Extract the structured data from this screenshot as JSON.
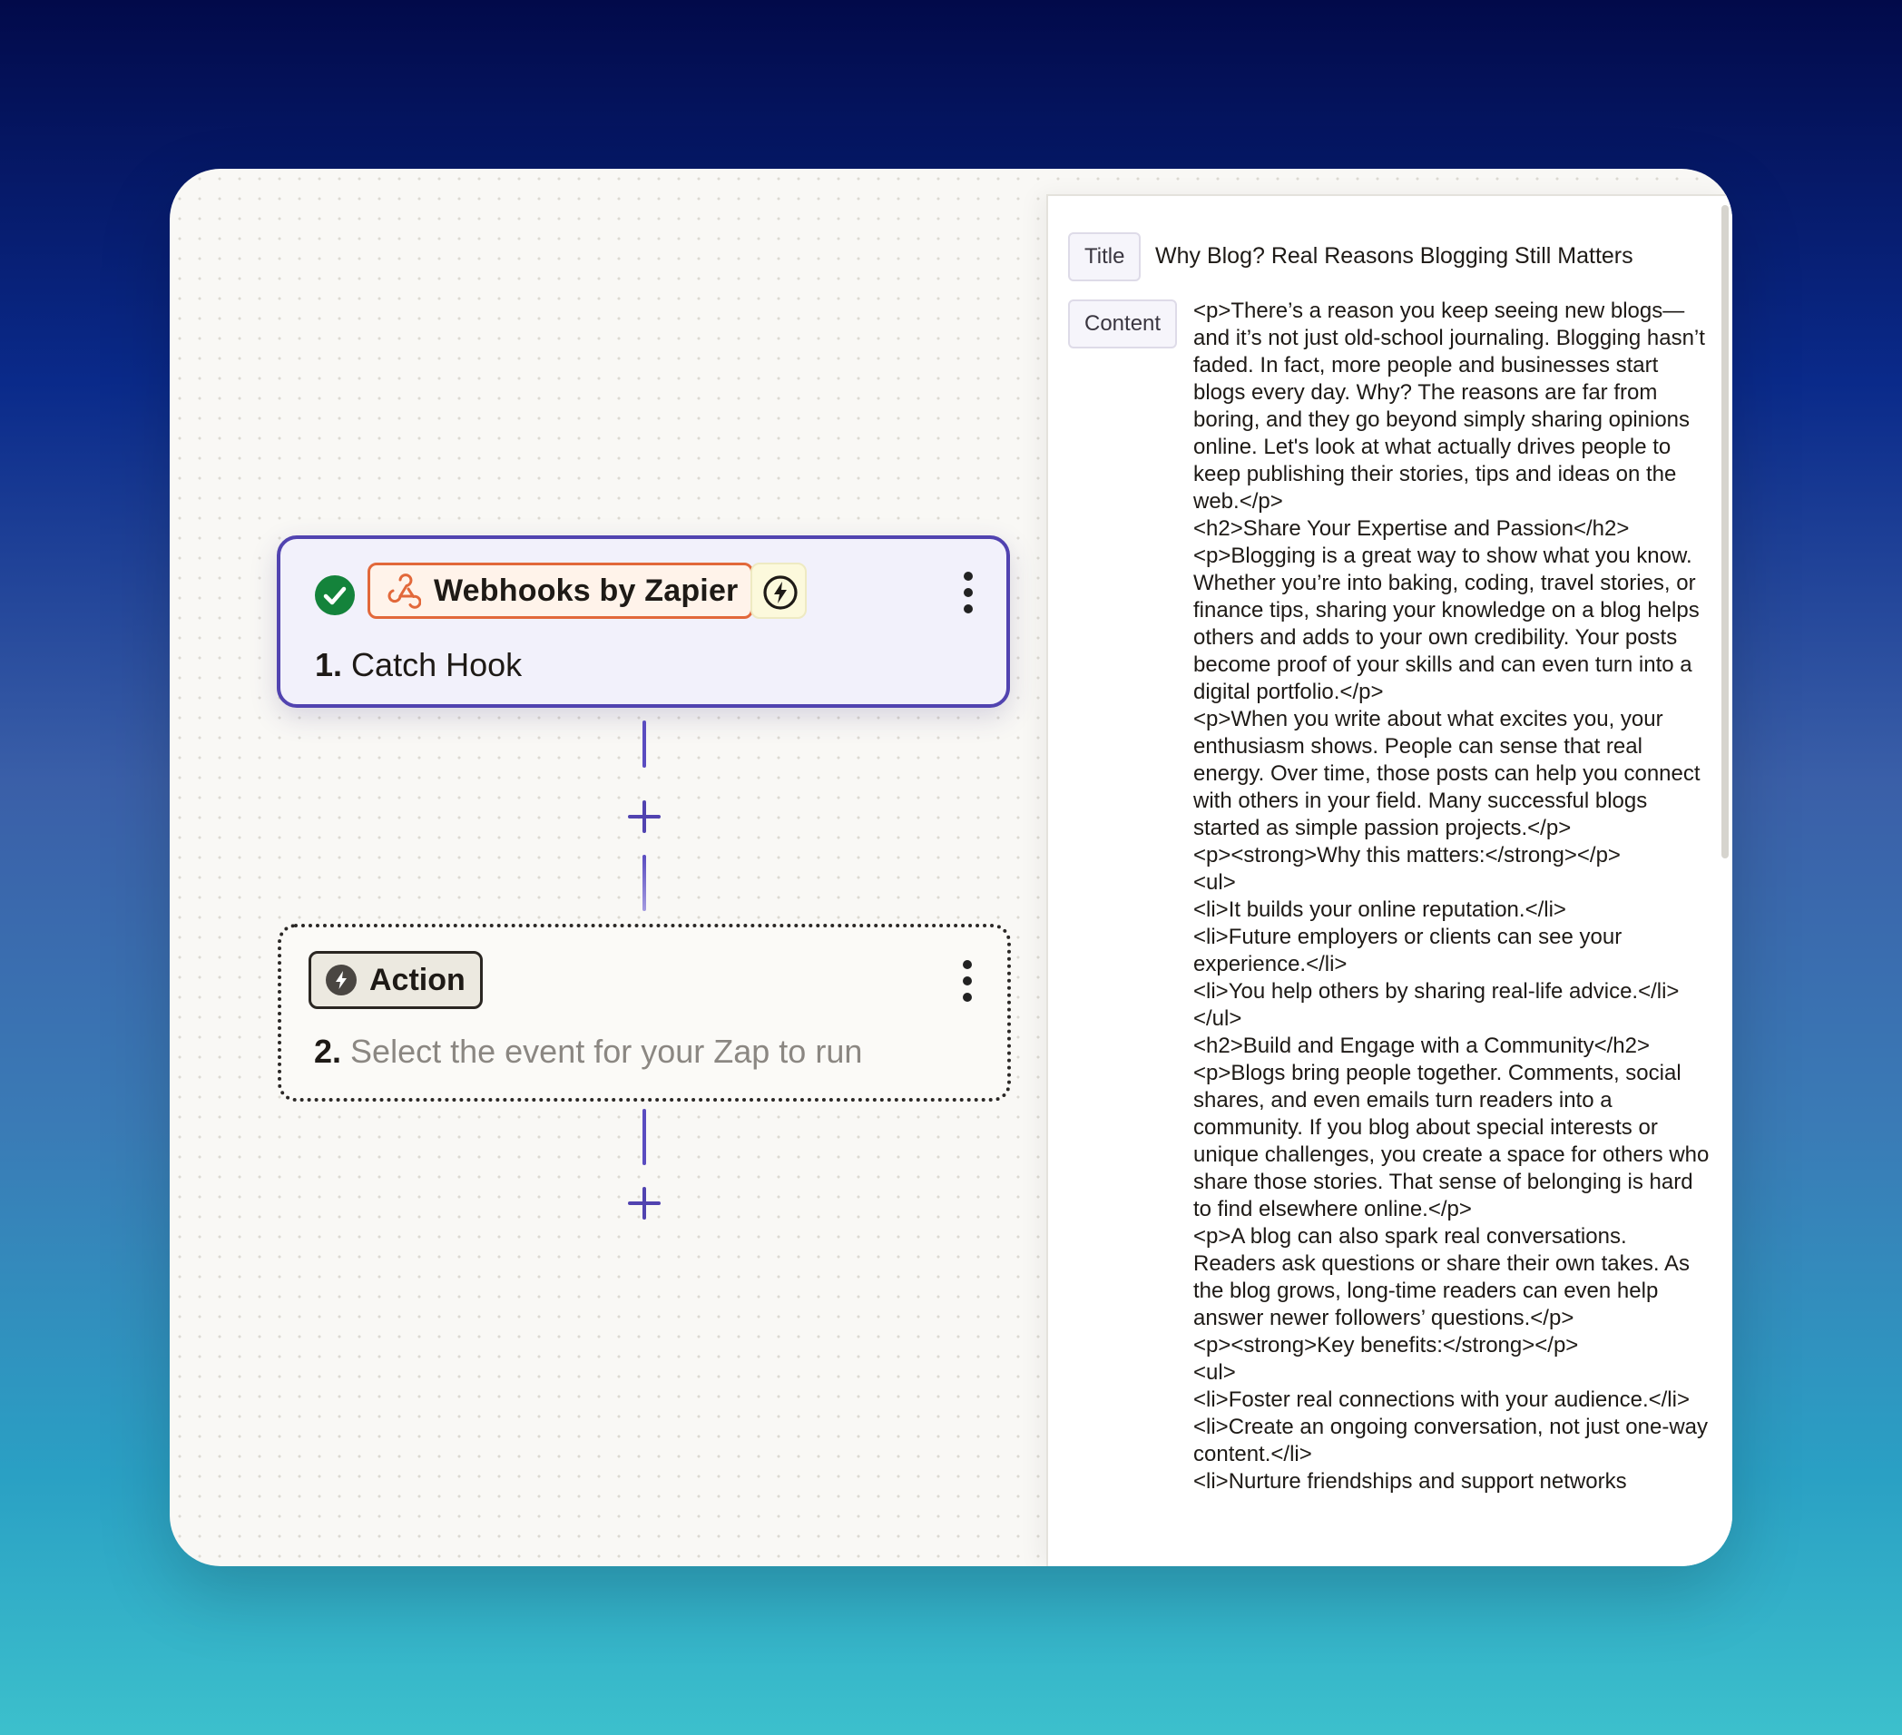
{
  "steps": [
    {
      "number": "1.",
      "app_name": "Webhooks by Zapier",
      "title": "Catch Hook",
      "status": "complete"
    },
    {
      "number": "2.",
      "app_name": "Action",
      "title": "Select the event for your Zap to run"
    }
  ],
  "panel": {
    "title_label": "Title",
    "title_value": "Why Blog? Real Reasons Blogging Still Matters",
    "content_label": "Content",
    "content_value": "<p>There’s a reason you keep seeing new blogs—and it’s not just old-school journaling. Blogging hasn’t faded. In fact, more people and businesses start blogs every day. Why? The reasons are far from boring, and they go beyond simply sharing opinions online. Let's look at what actually drives people to keep publishing their stories, tips and ideas on the web.</p>\n<h2>Share Your Expertise and Passion</h2>\n<p>Blogging is a great way to show what you know. Whether you’re into baking, coding, travel stories, or finance tips, sharing your knowledge on a blog helps others and adds to your own credibility. Your posts become proof of your skills and can even turn into a digital portfolio.</p>\n<p>When you write about what excites you, your enthusiasm shows. People can sense that real energy. Over time, those posts can help you connect with others in your field. Many successful blogs started as simple passion projects.</p>\n<p><strong>Why this matters:</strong></p>\n<ul>\n<li>It builds your online reputation.</li>\n<li>Future employers or clients can see your experience.</li>\n<li>You help others by sharing real-life advice.</li>\n</ul>\n<h2>Build and Engage with a Community</h2>\n<p>Blogs bring people together. Comments, social shares, and even emails turn readers into a community. If you blog about special interests or unique challenges, you create a space for others who share those stories. That sense of belonging is hard to find elsewhere online.</p>\n<p>A blog can also spark real conversations. Readers ask questions or share their own takes. As the blog grows, long-time readers can even help answer newer followers’ questions.</p>\n<p><strong>Key benefits:</strong></p>\n<ul>\n<li>Foster real connections with your audience.</li>\n<li>Create an ongoing conversation, not just one-way content.</li>\n<li>Nurture friendships and support networks"
  },
  "colors": {
    "accent": "#5143b0",
    "success": "#14833b",
    "webhook_orange": "#e2683a"
  }
}
